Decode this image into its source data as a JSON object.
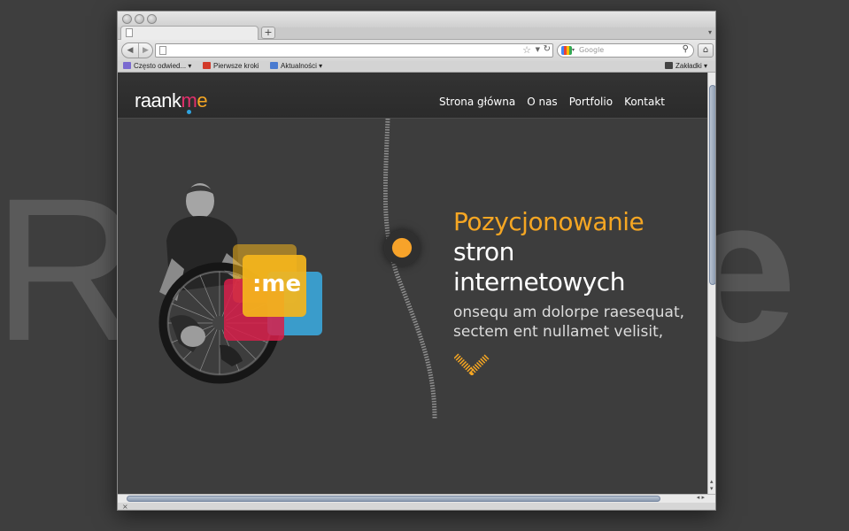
{
  "background": {
    "word": "Ra",
    "word_right": "e"
  },
  "browser": {
    "tab_menu_glyph": "▾",
    "new_tab_label": "+",
    "back_glyph": "◀",
    "forward_glyph": "▶",
    "url_value": "",
    "star_glyph": "☆",
    "reload_glyph": "↻",
    "search_placeholder": "Google",
    "search_icon": "magnifier-icon",
    "home_glyph": "⌂",
    "bookmarks": {
      "items": [
        {
          "label": "Często odwied... ▾",
          "icon_color": "#7a6ad0"
        },
        {
          "label": "Pierwsze kroki",
          "icon_color": "#d23a2a"
        },
        {
          "label": "Aktualności ▾",
          "icon_color": "#4a7bd0"
        }
      ],
      "right_label": "Zakładki ▾"
    },
    "status_text": "×",
    "scroll_arrows_h": "◂ ▸",
    "scroll_arrows_v": "▴\n▾"
  },
  "site": {
    "logo": {
      "part1": "raank",
      "part2": "m",
      "part3": "e"
    },
    "nav": [
      "Strona główna",
      "O nas",
      "Portfolio",
      "Kontakt"
    ],
    "badge_text": ":me",
    "hero": {
      "title_line1": "Pozycjonowanie",
      "title_line2": "stron",
      "title_line3": "internetowych",
      "sub_line1": "onsequ am dolorpe raesequat,",
      "sub_line2": "sectem ent nullamet velisit,"
    }
  },
  "colors": {
    "accent_orange": "#f5a623",
    "logo_pink": "#e1306c",
    "badge_red": "#d81f4a",
    "badge_yellow": "#f4b51c",
    "badge_blue": "#3aa6da"
  }
}
